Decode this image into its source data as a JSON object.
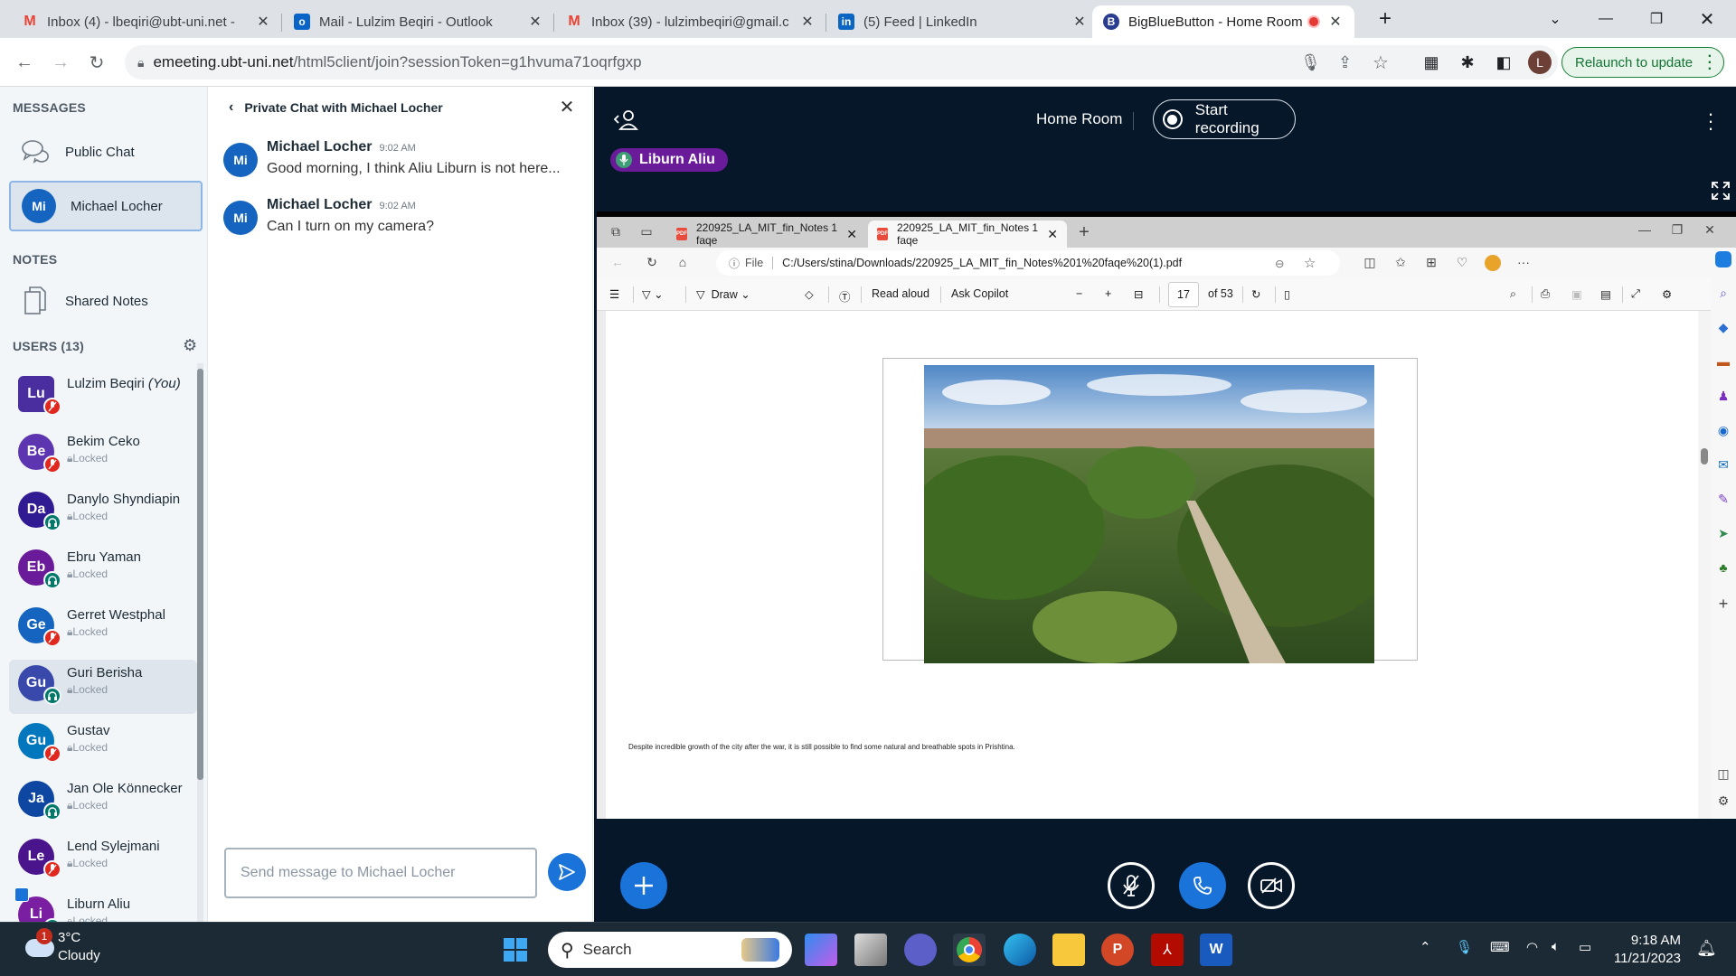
{
  "browser": {
    "tabs": [
      {
        "title": "Inbox (4) - lbeqiri@ubt-uni.net -",
        "icon": "gmail-icon"
      },
      {
        "title": "Mail - Lulzim Beqiri - Outlook",
        "icon": "outlook-icon"
      },
      {
        "title": "Inbox (39) - lulzimbeqiri@gmail.c",
        "icon": "gmail-icon"
      },
      {
        "title": "(5) Feed | LinkedIn",
        "icon": "linkedin-icon"
      },
      {
        "title": "BigBlueButton - Home Room",
        "icon": "bigbluebutton-icon",
        "active": true,
        "recording": true
      }
    ],
    "url_host": "emeeting.ubt-uni.net",
    "url_path": "/html5client/join?sessionToken=g1hvuma71oqrfgxp",
    "profile_initial": "L",
    "relaunch_label": "Relaunch to update"
  },
  "sidebar": {
    "messages_title": "MESSAGES",
    "public_chat": "Public Chat",
    "private_chat": {
      "initials": "Mi",
      "name": "Michael Locher"
    },
    "notes_title": "NOTES",
    "shared_notes": "Shared Notes",
    "users_title": "USERS (13)",
    "users": [
      {
        "initials": "Lu",
        "name": "Lulzim Beqiri",
        "you": "(You)",
        "status": "muted",
        "color": "#4a2ea0",
        "locked": ""
      },
      {
        "initials": "Be",
        "name": "Bekim Ceko",
        "status": "muted",
        "color": "#5e35b1",
        "locked": "Locked"
      },
      {
        "initials": "Da",
        "name": "Danylo Shyndiapin",
        "status": "listen",
        "color": "#311b92",
        "locked": "Locked"
      },
      {
        "initials": "Eb",
        "name": "Ebru Yaman",
        "status": "listen",
        "color": "#6a1b9a",
        "locked": "Locked"
      },
      {
        "initials": "Ge",
        "name": "Gerret Westphal",
        "status": "muted",
        "color": "#1565c0",
        "locked": "Locked"
      },
      {
        "initials": "Gu",
        "name": "Guri Berisha",
        "status": "listen",
        "color": "#3949ab",
        "locked": "Locked",
        "highlight": true
      },
      {
        "initials": "Gu",
        "name": "Gustav",
        "status": "muted",
        "color": "#0277bd",
        "locked": "Locked"
      },
      {
        "initials": "Ja",
        "name": "Jan Ole Könnecker",
        "status": "listen",
        "color": "#0d47a1",
        "locked": "Locked"
      },
      {
        "initials": "Le",
        "name": "Lend Sylejmani",
        "status": "muted",
        "color": "#4a148c",
        "locked": "Locked"
      },
      {
        "initials": "Li",
        "name": "Liburn Aliu",
        "status": "listen",
        "color": "#7b1fa2",
        "locked": "Locked",
        "presenter": true
      }
    ]
  },
  "chat": {
    "title": "Private Chat with Michael Locher",
    "messages": [
      {
        "initials": "Mi",
        "sender": "Michael Locher",
        "time": "9:02 AM",
        "text": "Good morning, I think Aliu Liburn is not here..."
      },
      {
        "initials": "Mi",
        "sender": "Michael Locher",
        "time": "9:02 AM",
        "text": "Can I turn on my camera?"
      }
    ],
    "input_placeholder": "Send message to Michael Locher"
  },
  "meeting": {
    "room_name": "Home Room",
    "record_label": "Start recording",
    "talking_user": "Liburn Aliu"
  },
  "screenshare": {
    "tabs": [
      {
        "title": "220925_LA_MIT_fin_Notes 1 faqe"
      },
      {
        "title": "220925_LA_MIT_fin_Notes 1 faqe",
        "active": true
      }
    ],
    "url_prefix": "File",
    "url": "C:/Users/stina/Downloads/220925_LA_MIT_fin_Notes%201%20faqe%20(1).pdf",
    "toolbar": {
      "draw": "Draw",
      "read_aloud": "Read aloud",
      "ask_copilot": "Ask Copilot",
      "page": "17",
      "of_pages": "of 53"
    },
    "caption": "Despite incredible growth of the city after the war, it is still possible to find some natural and breathable spots in Prishtina."
  },
  "taskbar": {
    "weather_temp": "3°C",
    "weather_desc": "Cloudy",
    "weather_badge": "1",
    "search_label": "Search",
    "time": "9:18 AM",
    "date": "11/21/2023"
  }
}
